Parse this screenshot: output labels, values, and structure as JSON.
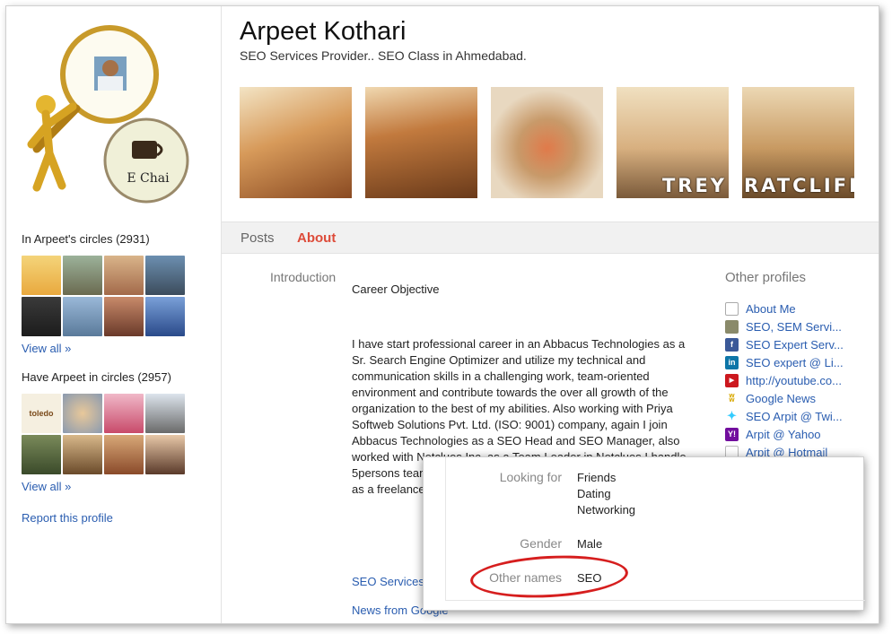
{
  "profile": {
    "name": "Arpeet Kothari",
    "tagline": "SEO Services Provider.. SEO Class in Ahmedabad.",
    "avatar_caption": "E Chai",
    "photo_caption_1": "TREY",
    "photo_caption_2": "RATCLIFF"
  },
  "left": {
    "in_circles_title": "In Arpeet's circles (2931)",
    "in_circles_view_all": "View all »",
    "have_in_circles_title": "Have Arpeet in circles (2957)",
    "have_in_circles_view_all": "View all »",
    "thumb_text": "toledo",
    "report": "Report this profile"
  },
  "tabs": {
    "posts": "Posts",
    "about": "About"
  },
  "about": {
    "intro_label": "Introduction",
    "career_objective": "Career Objective",
    "bio": "I have start professional career in an Abbacus Technologies as a Sr. Search Engine Optimizer and utilize my technical and communication skills in a challenging work, team-oriented environment and contribute towards the over all growth of the organization to the best of my abilities. Also working with Priya Softweb Solutions Pvt. Ltd. (ISO: 9001) company, again I join Abbacus Technologies as a SEO Head and SEO Manager, also worked with Netclues Inc. as a Team Leader in Netclues I handle 5persons team. 8+ years experience. Web as a PL. SEO Manager. as a freelancer. SEO, SMO &",
    "link_seo_services": "SEO Services",
    "link_news": "News from Google"
  },
  "other_profiles": {
    "title": "Other profiles",
    "items": [
      {
        "label": "About Me",
        "icon": "page-icon"
      },
      {
        "label": "SEO, SEM Servi...",
        "icon": "site-icon"
      },
      {
        "label": "SEO Expert Serv...",
        "icon": "facebook-icon"
      },
      {
        "label": "SEO expert @ Li...",
        "icon": "linkedin-icon"
      },
      {
        "label": "http://youtube.co...",
        "icon": "youtube-icon"
      },
      {
        "label": "Google News",
        "icon": "google-news-icon"
      },
      {
        "label": "SEO Arpit @ Twi...",
        "icon": "twitter-icon"
      },
      {
        "label": "Arpit @ Yahoo",
        "icon": "yahoo-icon"
      },
      {
        "label": "Arpit @ Hotmail",
        "icon": "hotmail-icon"
      }
    ]
  },
  "popup": {
    "looking_for_label": "Looking for",
    "looking_for_values": [
      "Friends",
      "Dating",
      "Networking"
    ],
    "gender_label": "Gender",
    "gender_value": "Male",
    "other_names_label": "Other names",
    "other_names_value": "SEO"
  },
  "colors": {
    "link": "#2a5db0",
    "active_tab": "#dd4b39",
    "highlight": "#d61e1e"
  }
}
